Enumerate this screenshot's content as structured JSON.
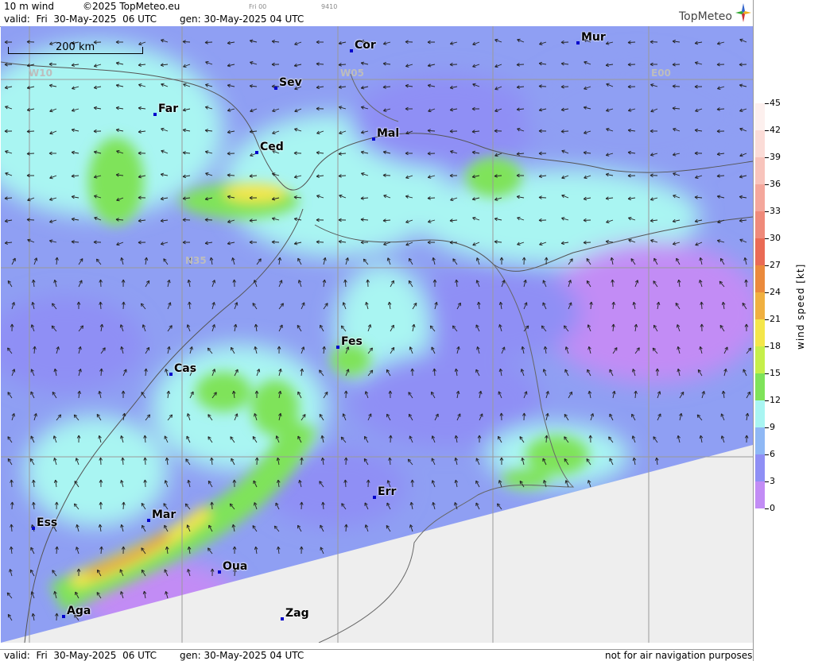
{
  "header": {
    "product": "10 m wind",
    "copyright": "©2025 TopMeteo.eu",
    "step": "Fri 00",
    "code": "9410",
    "valid_label": "valid:",
    "valid_day": "Fri",
    "valid_date": "30-May-2025",
    "valid_time": "06 UTC",
    "gen_label": "gen:",
    "gen_value": "30-May-2025 04 UTC",
    "logo_text": "TopMeteo"
  },
  "footer": {
    "valid_label": "valid:",
    "valid_day": "Fri",
    "valid_date": "30-May-2025",
    "valid_time": "06 UTC",
    "gen_label": "gen:",
    "gen_value": "30-May-2025 04 UTC",
    "disclaimer": "not for air navigation purposes"
  },
  "scalebar": {
    "label": "200 km"
  },
  "grid_labels": {
    "w10": "W10",
    "w05": "W05",
    "e00": "E00",
    "n35": "N35"
  },
  "cities": [
    {
      "name": "Cor"
    },
    {
      "name": "Mur"
    },
    {
      "name": "Sev"
    },
    {
      "name": "Far"
    },
    {
      "name": "Mal"
    },
    {
      "name": "Ced"
    },
    {
      "name": "Fes"
    },
    {
      "name": "Cas"
    },
    {
      "name": "Err"
    },
    {
      "name": "Mar"
    },
    {
      "name": "Ess"
    },
    {
      "name": "Oua"
    },
    {
      "name": "Aga"
    },
    {
      "name": "Zag"
    }
  ],
  "legend": {
    "title": "wind speed [kt]",
    "ticks": [
      "45",
      "42",
      "39",
      "36",
      "33",
      "30",
      "27",
      "24",
      "21",
      "18",
      "15",
      "12",
      "9",
      "6",
      "3",
      "0"
    ],
    "colors": [
      "#fdf0ee",
      "#fbdcd7",
      "#f8c4bc",
      "#f4a79c",
      "#ef8a7a",
      "#ea6b55",
      "#eb8a3c",
      "#f0b040",
      "#f4e64a",
      "#c6ef4a",
      "#7fe35a",
      "#a9f5f2",
      "#8fb8f5",
      "#8f8ff5",
      "#c28cf5"
    ],
    "palette": {
      "no_data": "#eeeeee",
      "accent_dot": "#0000cc"
    }
  }
}
